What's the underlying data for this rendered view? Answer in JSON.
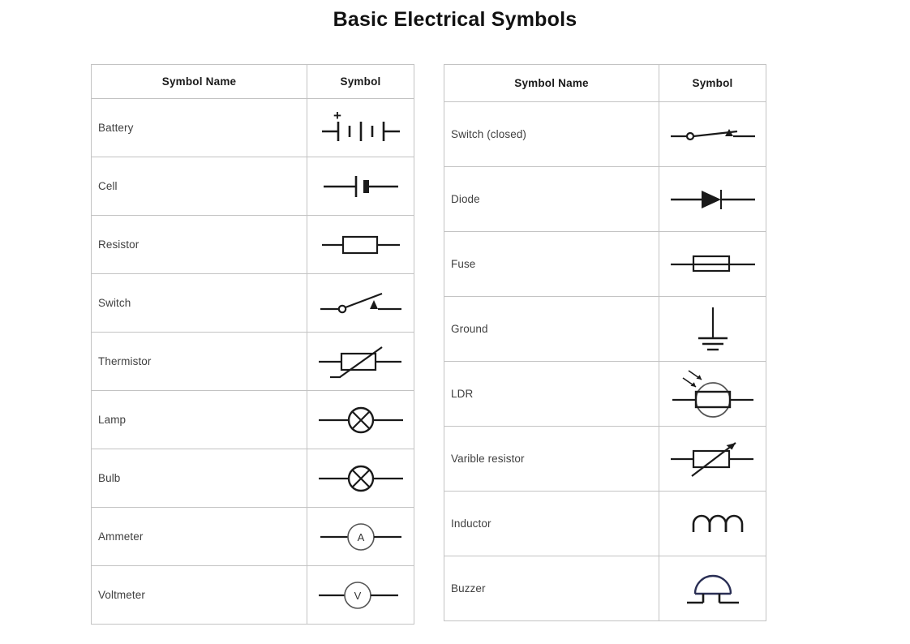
{
  "page": {
    "title": "Basic Electrical Symbols",
    "background_color": "#ffffff",
    "text_color": "#404040",
    "border_color": "#c3c3c3",
    "stroke_color": "#1a1a1a",
    "accent_color": "#2a2f55"
  },
  "tables": {
    "left": {
      "headers": {
        "name": "Symbol Name",
        "symbol": "Symbol"
      },
      "rows": [
        {
          "name": "Battery",
          "icon": "battery-symbol"
        },
        {
          "name": "Cell",
          "icon": "cell-symbol"
        },
        {
          "name": "Resistor",
          "icon": "resistor-symbol"
        },
        {
          "name": "Switch",
          "icon": "switch-open-symbol"
        },
        {
          "name": "Thermistor",
          "icon": "thermistor-symbol"
        },
        {
          "name": "Lamp",
          "icon": "lamp-symbol"
        },
        {
          "name": "Bulb",
          "icon": "bulb-symbol"
        },
        {
          "name": "Ammeter",
          "icon": "ammeter-symbol",
          "label": "A"
        },
        {
          "name": "Voltmeter",
          "icon": "voltmeter-symbol",
          "label": "V"
        }
      ]
    },
    "right": {
      "headers": {
        "name": "Symbol Name",
        "symbol": "Symbol"
      },
      "rows": [
        {
          "name": "Switch (closed)",
          "icon": "switch-closed-symbol"
        },
        {
          "name": "Diode",
          "icon": "diode-symbol"
        },
        {
          "name": "Fuse",
          "icon": "fuse-symbol"
        },
        {
          "name": "Ground",
          "icon": "ground-symbol"
        },
        {
          "name": "LDR",
          "icon": "ldr-symbol"
        },
        {
          "name": "Varible resistor",
          "icon": "variable-resistor-symbol"
        },
        {
          "name": "Inductor",
          "icon": "inductor-symbol"
        },
        {
          "name": "Buzzer",
          "icon": "buzzer-symbol"
        }
      ]
    }
  },
  "symbol_marks": {
    "battery_plus": "+",
    "ammeter_letter": "A",
    "voltmeter_letter": "V"
  }
}
